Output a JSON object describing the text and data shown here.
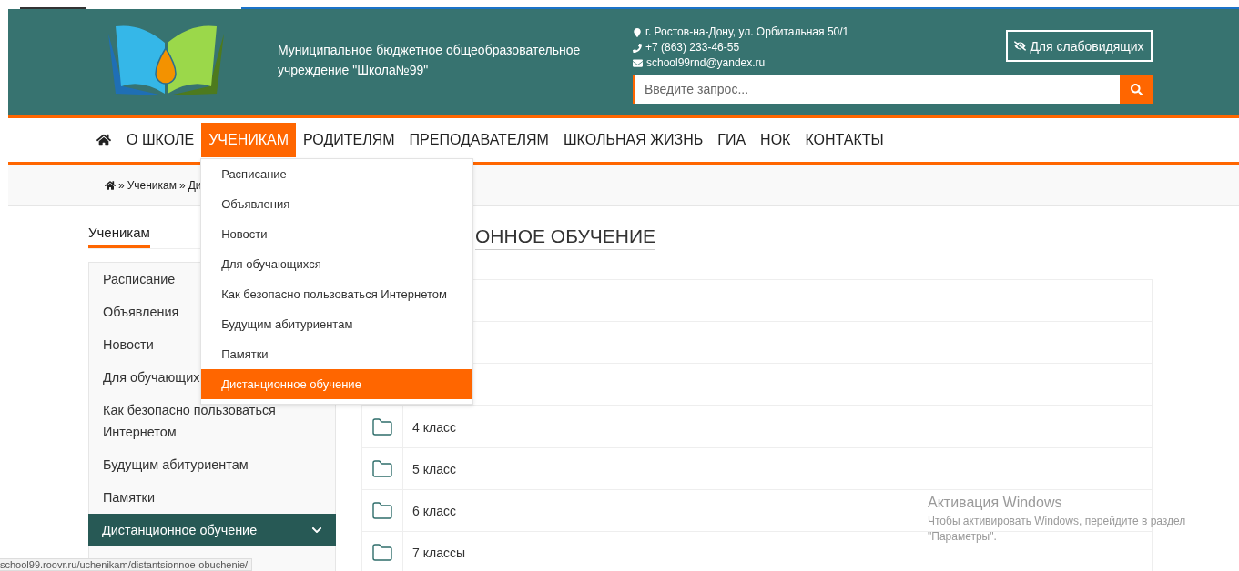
{
  "header": {
    "org_name": "Муниципальное бюджетное общеобразовательное учреждение \"Школа№99\"",
    "address": "г. Ростов-на-Дону, ул. Орбитальная 50/1",
    "phone": "+7 (863) 233-46-55",
    "email": "school99rnd@yandex.ru",
    "accessibility_button": "Для слабовидящих",
    "search": {
      "placeholder": "Введите запрос..."
    }
  },
  "nav": [
    {
      "label": "О ШКОЛЕ",
      "selected": false
    },
    {
      "label": "УЧЕНИКАМ",
      "selected": true
    },
    {
      "label": "РОДИТЕЛЯМ",
      "selected": false
    },
    {
      "label": "ПРЕПОДАВАТЕЛЯМ",
      "selected": false
    },
    {
      "label": "ШКОЛЬНАЯ ЖИЗНЬ",
      "selected": false
    },
    {
      "label": "ГИА",
      "selected": false
    },
    {
      "label": "НОК",
      "selected": false
    },
    {
      "label": "КОНТАКТЫ",
      "selected": false
    }
  ],
  "dropdown": {
    "items": [
      {
        "label": "Расписание",
        "selected": false
      },
      {
        "label": "Объявления",
        "selected": false
      },
      {
        "label": "Новости",
        "selected": false
      },
      {
        "label": "Для обучающихся",
        "selected": false
      },
      {
        "label": "Как безопасно пользоваться Интернетом",
        "selected": false
      },
      {
        "label": "Будущим абитуриентам",
        "selected": false
      },
      {
        "label": "Памятки",
        "selected": false
      },
      {
        "label": "Дистанционное обучение",
        "selected": true
      }
    ]
  },
  "breadcrumb": {
    "separator": "»",
    "items": [
      "Ученикам",
      "Ди"
    ]
  },
  "sidebar": {
    "title": "Ученикам",
    "items": [
      {
        "label": "Расписание",
        "selected": false
      },
      {
        "label": "Объявления",
        "selected": false
      },
      {
        "label": "Новости",
        "selected": false
      },
      {
        "label": "Для обучающих",
        "selected": false
      },
      {
        "label": "Как безопасно пользоваться Интернетом",
        "selected": false
      },
      {
        "label": "Будущим абитуриентам",
        "selected": false
      },
      {
        "label": "Памятки",
        "selected": false
      },
      {
        "label": "Дистанционное обучение",
        "selected": true
      }
    ]
  },
  "content": {
    "title": "ОННОЕ ОБУЧЕНИЕ",
    "rows": [
      "4 класс",
      "5 класс",
      "6 класс",
      "7 классы"
    ]
  },
  "status_bar": {
    "url": "school99.roovr.ru/uchenikam/distantsionnoe-obuchenie/"
  },
  "os_notice": {
    "title": "Активация Windows",
    "text": "Чтобы активировать Windows, перейдите в раздел \"Параметры\"."
  }
}
